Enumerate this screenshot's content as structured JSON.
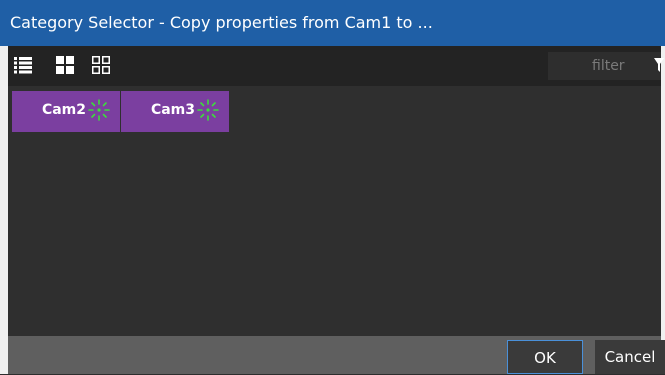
{
  "dialog": {
    "title": "Category Selector - Copy properties from Cam1 to ..."
  },
  "toolbar": {
    "views": [
      {
        "name": "list-view",
        "icon": "list-icon"
      },
      {
        "name": "large-tile-view",
        "icon": "large-grid-icon"
      },
      {
        "name": "small-tile-view",
        "icon": "small-grid-icon"
      }
    ],
    "filter_placeholder": "filter",
    "filter_icon": "funnel-icon"
  },
  "tiles": [
    {
      "label": "Cam2",
      "icon": "spinner-icon"
    },
    {
      "label": "Cam3",
      "icon": "spinner-icon"
    }
  ],
  "footer": {
    "ok_label": "OK",
    "cancel_label": "Cancel"
  },
  "colors": {
    "title_bar": "#1f5fa6",
    "tile": "#7b3fa0",
    "spinner": "#3ddc3d",
    "ok_border": "#4a90d9"
  }
}
